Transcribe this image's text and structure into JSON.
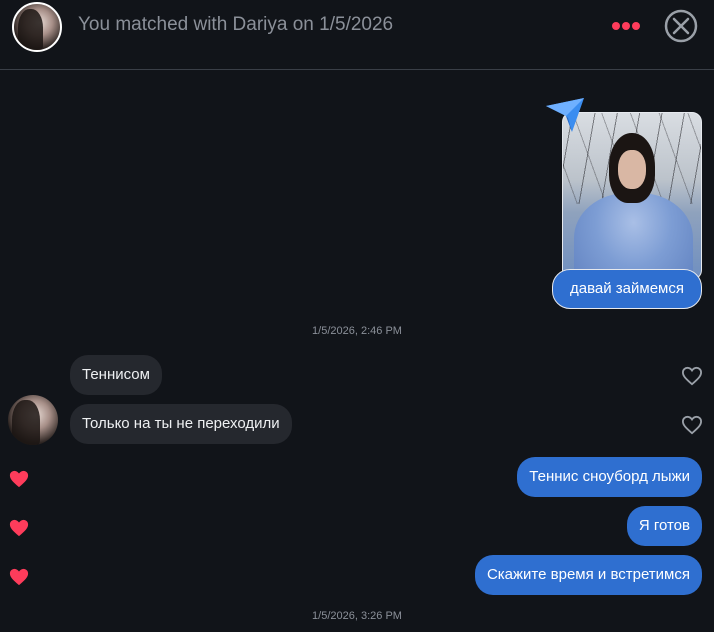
{
  "header": {
    "title": "You matched with Dariya on 1/5/2026",
    "avatar_icon": "profile-avatar",
    "more_icon": "more-dots-icon",
    "close_icon": "close-circle-icon"
  },
  "colors": {
    "background": "#111419",
    "accent_red": "#fe3c5b",
    "outgoing_bubble": "#2f6fd0",
    "incoming_bubble": "#25282e",
    "muted_text": "#8b9099"
  },
  "messages_top": {
    "photo_icon": "sent-photo",
    "send_icon": "paper-plane-icon",
    "caption": "давай займемся"
  },
  "timestamps": {
    "first": "1/5/2026, 2:46 PM",
    "second": "1/5/2026, 3:26 PM"
  },
  "incoming": [
    {
      "text": "Теннисом",
      "liked": false
    },
    {
      "text": "Только на ты не переходили",
      "liked": false
    }
  ],
  "outgoing": [
    {
      "text": "Теннис сноуборд лыжи",
      "liked": true
    },
    {
      "text": "Я готов",
      "liked": true
    },
    {
      "text": "Скажите время и встретимся",
      "liked": true
    }
  ]
}
